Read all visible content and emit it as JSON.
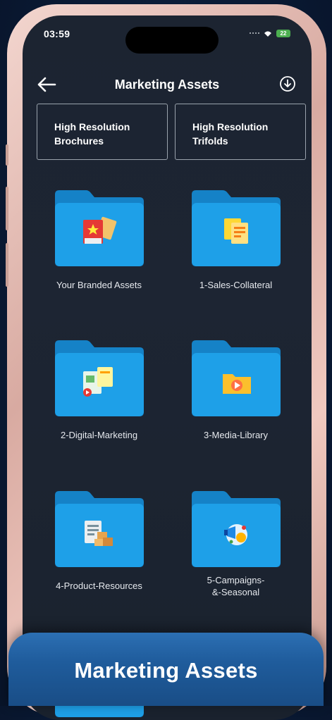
{
  "status_bar": {
    "time": "03:59",
    "battery": "22"
  },
  "header": {
    "title": "Marketing Assets"
  },
  "quick_links": [
    {
      "label": "High Resolution\nBrochures"
    },
    {
      "label": "High Resolution\nTrifolds"
    }
  ],
  "folders": [
    {
      "label": "Your Branded Assets",
      "icon": "branded-assets-icon"
    },
    {
      "label": "1-Sales-Collateral",
      "icon": "documents-icon"
    },
    {
      "label": "2-Digital-Marketing",
      "icon": "digital-marketing-icon"
    },
    {
      "label": "3-Media-Library",
      "icon": "play-media-icon"
    },
    {
      "label": "4-Product-Resources",
      "icon": "product-resources-icon"
    },
    {
      "label": "5-Campaigns-\n&-Seasonal",
      "icon": "campaign-megaphone-icon"
    }
  ],
  "banner": {
    "title": "Marketing Assets"
  },
  "colors": {
    "folder_blue": "#1ea0e8",
    "folder_tab": "#1582c7",
    "screen_bg": "#1c2431",
    "banner_blue": "#1f5c9c"
  }
}
